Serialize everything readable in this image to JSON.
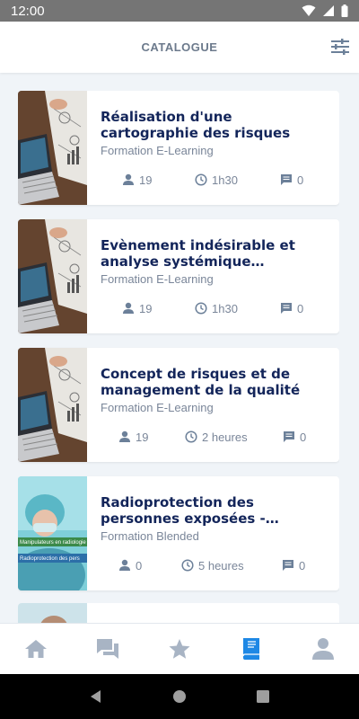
{
  "status_bar": {
    "time": "12:00"
  },
  "app_bar": {
    "title": "CATALOGUE"
  },
  "courses": [
    {
      "title": "Réalisation d'une cartographie des risques",
      "type": "Formation E-Learning",
      "learners": "19",
      "duration": "1h30",
      "comments": "0",
      "image": "laptop-desk"
    },
    {
      "title": "Evènement indésirable et analyse systémique d’incident",
      "type": "Formation E-Learning",
      "learners": "19",
      "duration": "1h30",
      "comments": "0",
      "image": "laptop-desk"
    },
    {
      "title": "Concept de risques et de management de la qualité",
      "type": "Formation E-Learning",
      "learners": "19",
      "duration": "2 heures",
      "comments": "0",
      "image": "laptop-desk"
    },
    {
      "title": "Radioprotection des personnes exposées - Manipu...",
      "type": "Formation Blended",
      "learners": "0",
      "duration": "5 heures",
      "comments": "0",
      "image": "radioprotection",
      "thumb_text_1": "Manipulateurs en radiologie",
      "thumb_text_2": "Radioprotection des pers"
    }
  ],
  "bottom_nav": [
    "home-icon",
    "chat-icon",
    "star-icon",
    "book-icon",
    "person-icon"
  ],
  "colors": {
    "accent": "#1e88e5",
    "title": "#13255a",
    "muted": "#7a8699",
    "nav_inactive": "#a8b4c4"
  }
}
